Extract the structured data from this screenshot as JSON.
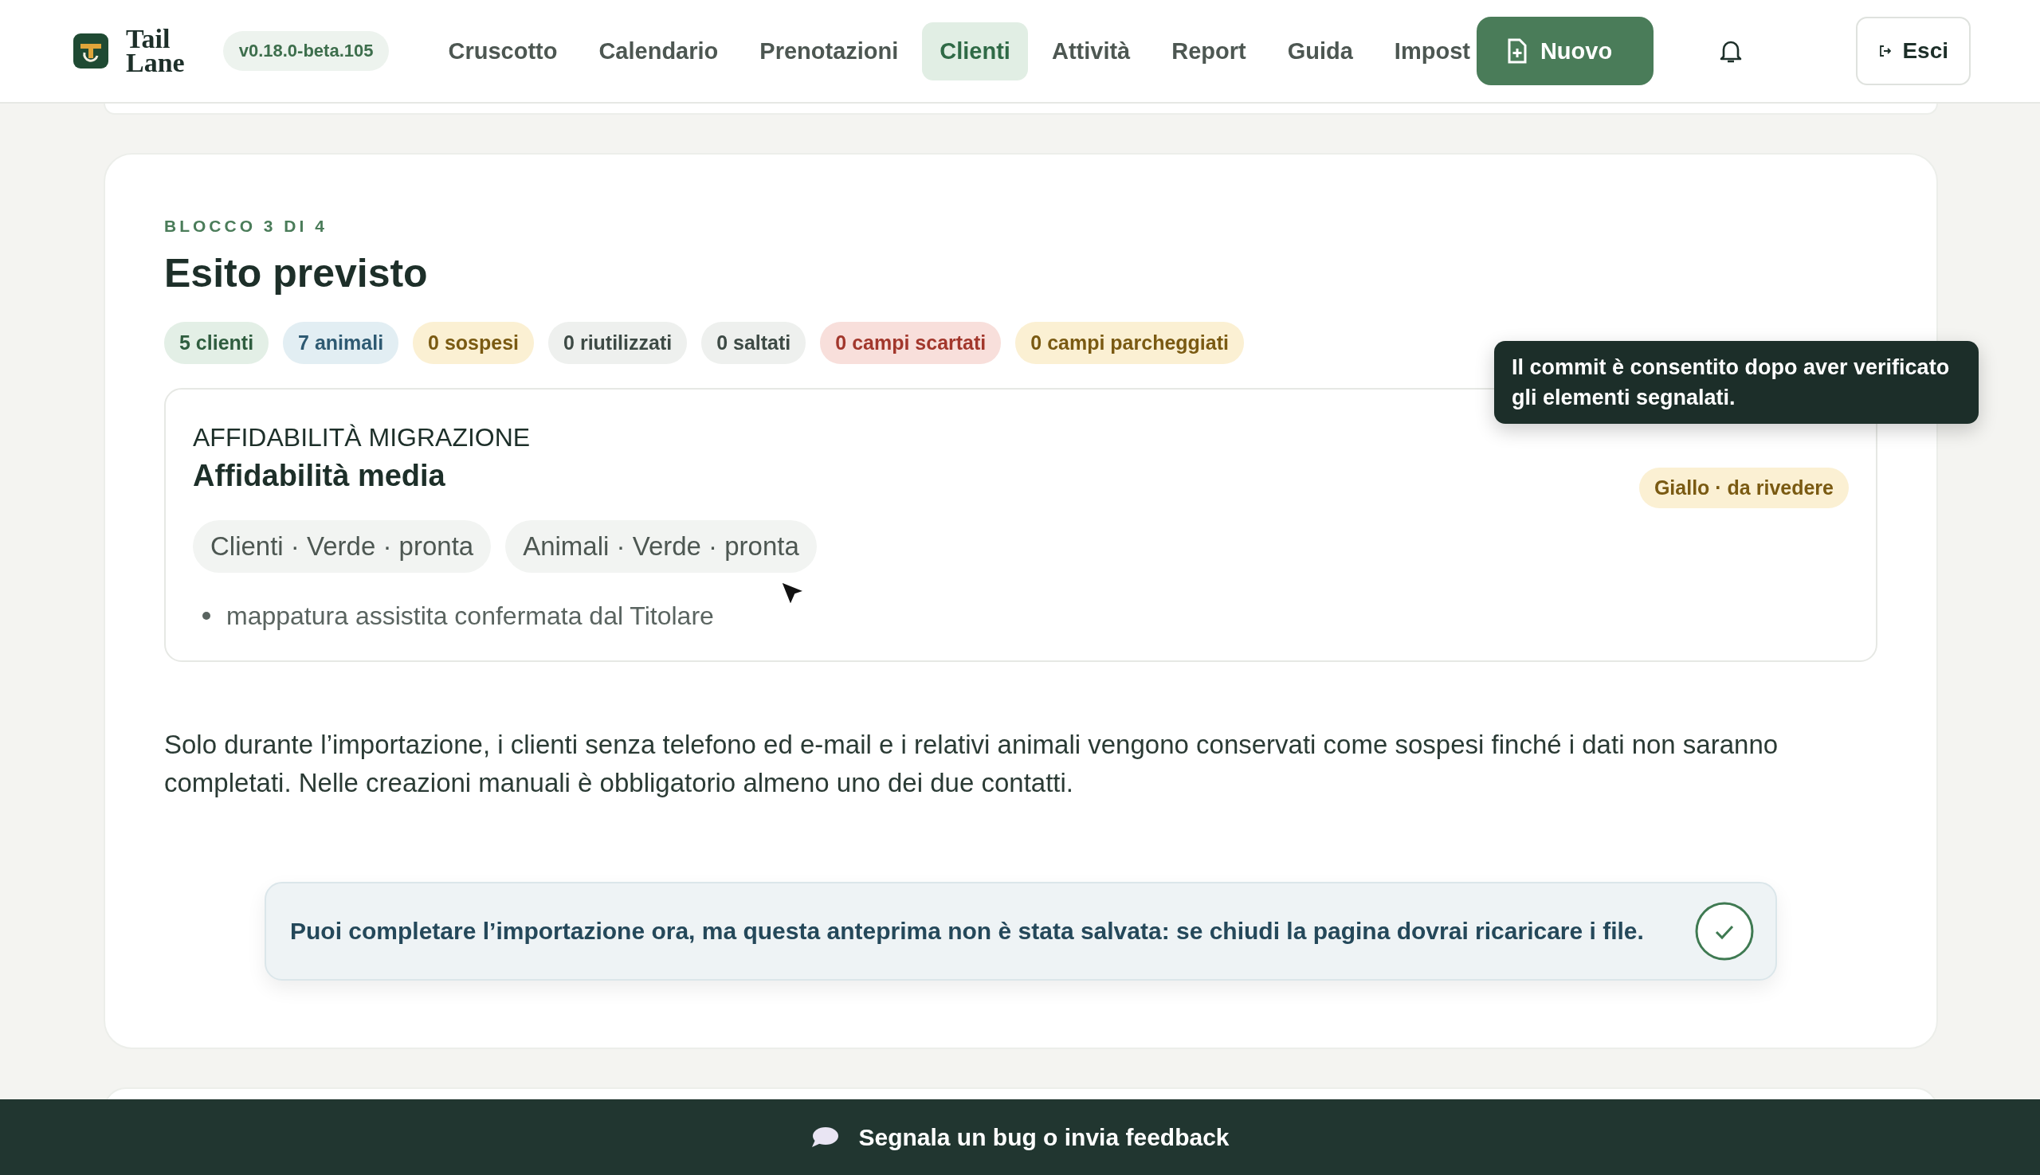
{
  "header": {
    "logo_text": [
      "Tail",
      "Lane"
    ],
    "version": "v0.18.0-beta.105",
    "nav": [
      {
        "label": "Cruscotto",
        "selected": false
      },
      {
        "label": "Calendario",
        "selected": false
      },
      {
        "label": "Prenotazioni",
        "selected": false
      },
      {
        "label": "Clienti",
        "selected": true
      },
      {
        "label": "Attività",
        "selected": false
      },
      {
        "label": "Report",
        "selected": false
      },
      {
        "label": "Guida",
        "selected": false
      },
      {
        "label": "Impost",
        "selected": false
      }
    ],
    "new_button": "Nuovo",
    "logout_button": "Esci"
  },
  "section": {
    "kicker": "BLOCCO 3 DI 4",
    "title": "Esito previsto",
    "chips": [
      {
        "label": "5 clienti",
        "kind": "success"
      },
      {
        "label": "7 animali",
        "kind": "info"
      },
      {
        "label": "0 sospesi",
        "kind": "warning"
      },
      {
        "label": "0 riutilizzati",
        "kind": "neutral"
      },
      {
        "label": "0 saltati",
        "kind": "neutral"
      },
      {
        "label": "0 campi scartati",
        "kind": "danger"
      },
      {
        "label": "0 campi parcheggiati",
        "kind": "warning"
      }
    ],
    "reliability": {
      "overline": "AFFIDABILITÀ MIGRAZIONE",
      "title": "Affidabilità media",
      "status": {
        "label": "Giallo · da rivedere",
        "kind": "warning"
      },
      "tags": [
        "Clienti · Verde · pronta",
        "Animali · Verde · pronta"
      ],
      "notes": [
        "mappatura assistita confermata dal Titolare"
      ]
    },
    "tooltip": "Il commit è consentito dopo aver verificato gli elementi segnalati.",
    "paragraph": "Solo durante l’importazione, i clienti senza telefono ed e-mail e i relativi animali vengono conservati come sospesi finché i dati non saranno completati. Nelle creazioni manuali è obbligatorio almeno uno dei due contatti.",
    "notice": "Puoi completare l’importazione ora, ma questa anteprima non è stata salvata: se chiudi la pagina dovrai ricaricare i file."
  },
  "feedback_bar": "Segnala un bug o invia feedback"
}
